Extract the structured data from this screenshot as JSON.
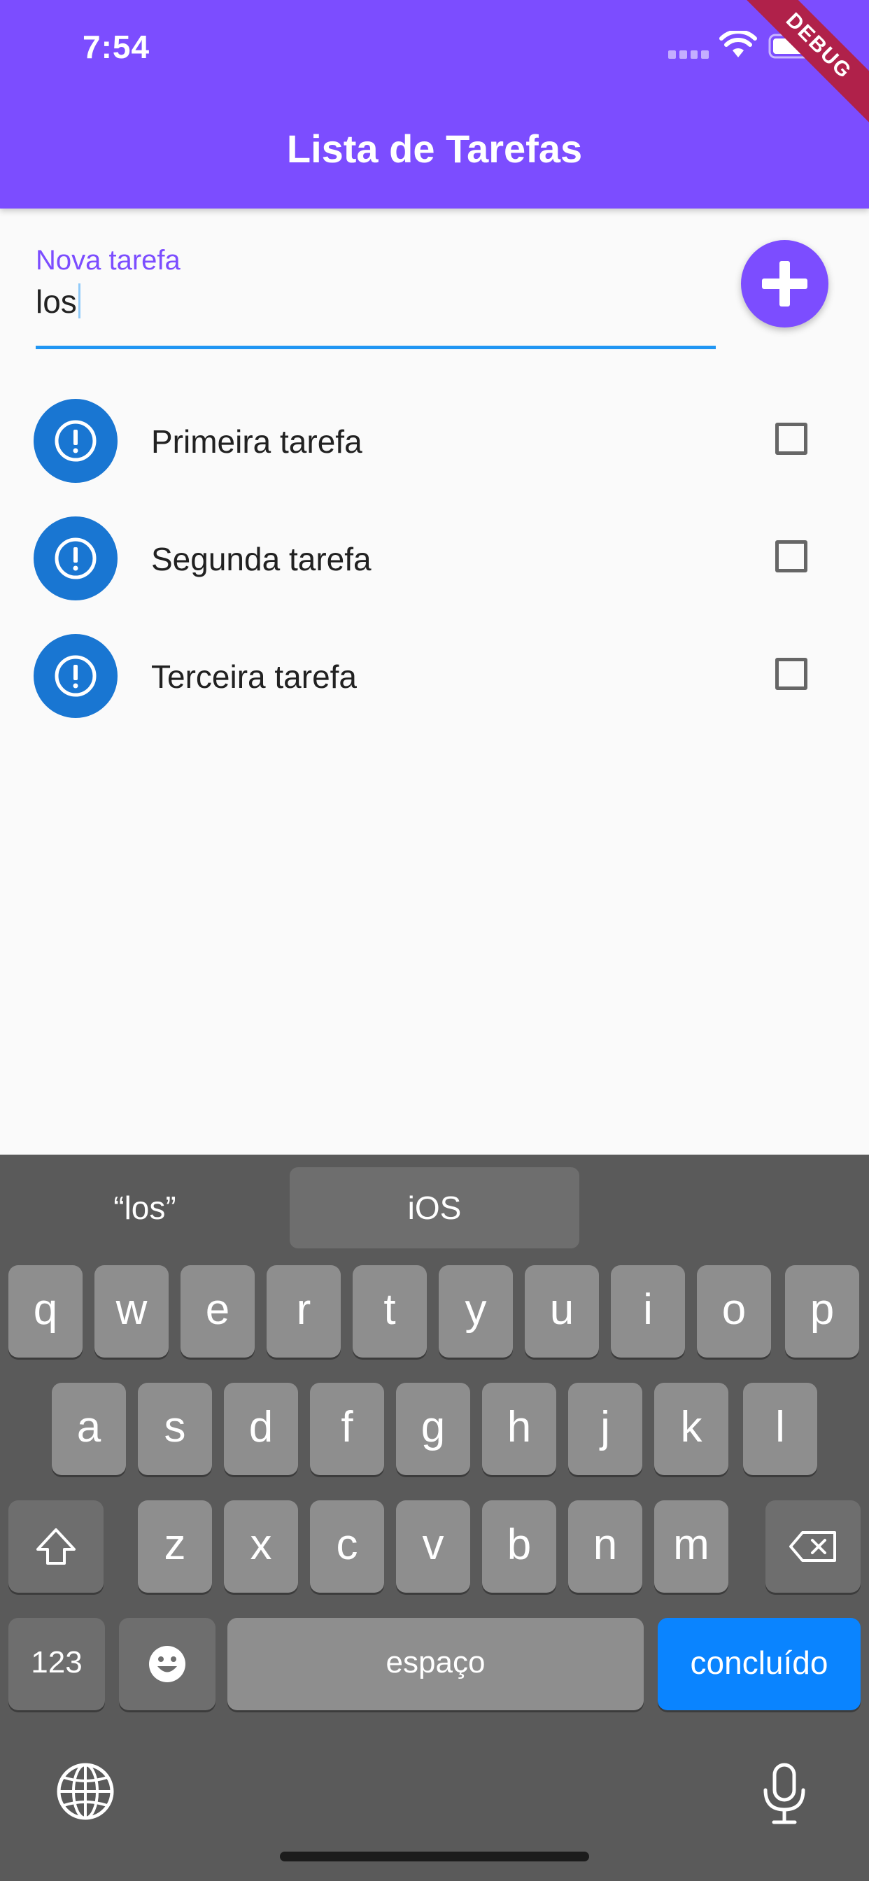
{
  "status_bar": {
    "time": "7:54"
  },
  "debug_banner": "DEBUG",
  "app_bar": {
    "title": "Lista de Tarefas"
  },
  "new_task": {
    "label": "Nova tarefa",
    "value": "los"
  },
  "tasks": [
    {
      "label": "Primeira tarefa",
      "checked": false
    },
    {
      "label": "Segunda tarefa",
      "checked": false
    },
    {
      "label": "Terceira tarefa",
      "checked": false
    }
  ],
  "keyboard": {
    "suggestions": [
      "“los”",
      "iOS"
    ],
    "row1": [
      "q",
      "w",
      "e",
      "r",
      "t",
      "y",
      "u",
      "i",
      "o",
      "p"
    ],
    "row2": [
      "a",
      "s",
      "d",
      "f",
      "g",
      "h",
      "j",
      "k",
      "l"
    ],
    "row3": [
      "z",
      "x",
      "c",
      "v",
      "b",
      "n",
      "m"
    ],
    "numbers_key": "123",
    "space_key": "espaço",
    "done_key": "concluído"
  },
  "colors": {
    "app_bar": "#7c4dff",
    "avatar": "#1976d2",
    "underline": "#2196f3",
    "done_key": "#0a84ff",
    "keyboard_bg": "#5a5a5a"
  }
}
